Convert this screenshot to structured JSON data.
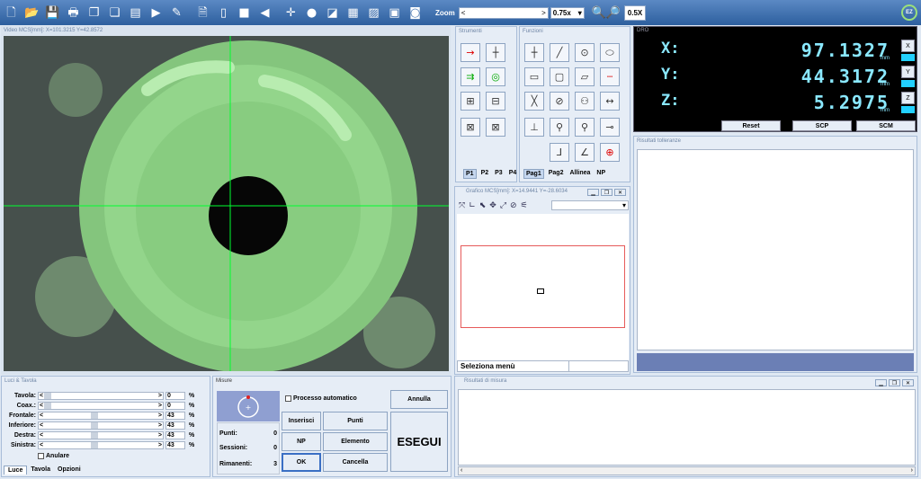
{
  "toolbar": {
    "zoom_label": "Zoom",
    "zoom_slider_left": "<",
    "zoom_slider_right": ">",
    "zoom_select": "0.75x",
    "zoom_value": "0.5X",
    "ez_label": "EZ"
  },
  "video": {
    "title": "Video",
    "coords": "MCS[mm]: X=101.3215 Y=42.8572"
  },
  "strumenti": {
    "title": "Strumenti",
    "pages": [
      "P1",
      "P2",
      "P3",
      "P4"
    ]
  },
  "funzioni": {
    "title": "Funzioni",
    "pages": [
      "Pag1",
      "Pag2",
      "Allinea",
      "NP"
    ]
  },
  "grafico": {
    "title": "Grafico",
    "coords": "MCS[mm]: X=14.9441 Y=-28.6034",
    "status_left": "Seleziona menù"
  },
  "dro": {
    "title": "DRO",
    "x_label": "X:",
    "x_value": "97.1327",
    "x_btn": "X",
    "y_label": "Y:",
    "y_value": "44.3172",
    "y_btn": "Y",
    "z_label": "Z:",
    "z_value": "5.2975",
    "z_btn": "Z",
    "unit": "mm",
    "reset": "Reset",
    "scp": "SCP",
    "scm": "SCM"
  },
  "tolleranze": {
    "title": "Risultati tolleranze"
  },
  "luci": {
    "title": "Luci & Tavola",
    "rows": [
      {
        "label": "Tavola:",
        "value": "0",
        "pct": "%",
        "level": 0
      },
      {
        "label": "Coax.:",
        "value": "0",
        "pct": "%",
        "level": 0
      },
      {
        "label": "Frontale:",
        "value": "43",
        "pct": "%",
        "level": 0.43
      },
      {
        "label": "Inferiore:",
        "value": "43",
        "pct": "%",
        "level": 0.43
      },
      {
        "label": "Destra:",
        "value": "43",
        "pct": "%",
        "level": 0.43
      },
      {
        "label": "Sinistra:",
        "value": "43",
        "pct": "%",
        "level": 0.43
      }
    ],
    "anulare": "Anulare",
    "tabs": [
      "Luce",
      "Tavola",
      "Opzioni"
    ],
    "arrow_left": "<",
    "arrow_right": ">"
  },
  "misure": {
    "title": "Misure",
    "processo": "Processo automatico",
    "annulla": "Annulla",
    "inserisci": "Inserisci",
    "punti_btn": "Punti",
    "np": "NP",
    "elemento": "Elemento",
    "esegui": "ESEGUI",
    "ok": "OK",
    "cancella": "Cancella",
    "punti_label": "Punti:",
    "punti_value": "0",
    "sessioni_label": "Sessioni:",
    "sessioni_value": "0",
    "rimanenti_label": "Rimanenti:",
    "rimanenti_value": "3"
  },
  "risultati": {
    "title": "Risultati di misura"
  }
}
